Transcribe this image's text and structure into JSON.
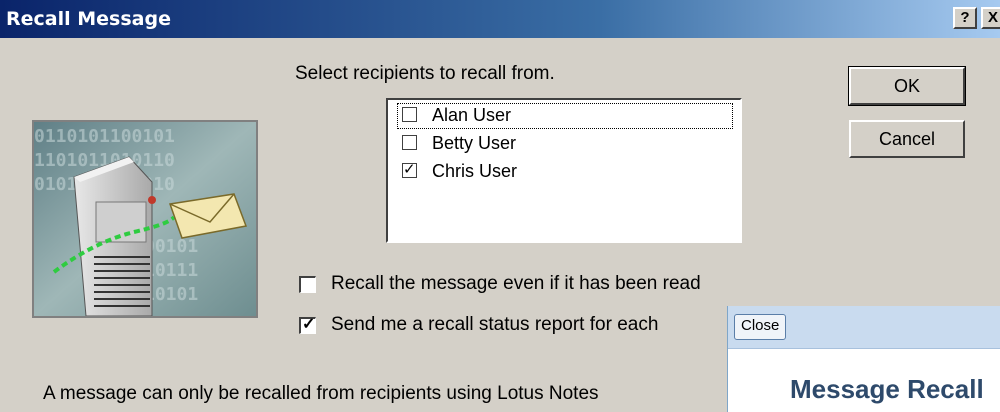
{
  "window": {
    "title": "Recall Message",
    "help_label": "?",
    "close_label": "X"
  },
  "instructions": "Select recipients to recall from.",
  "recipients": [
    {
      "name": "Alan User",
      "checked": false,
      "focused": true
    },
    {
      "name": "Betty User",
      "checked": false,
      "focused": false
    },
    {
      "name": "Chris User",
      "checked": true,
      "focused": false
    }
  ],
  "buttons": {
    "ok": "OK",
    "cancel": "Cancel"
  },
  "options": {
    "recall_if_read": {
      "label": "Recall the message even if it has been read",
      "checked": false
    },
    "status_report": {
      "label": "Send me a recall status report for each",
      "checked": true
    }
  },
  "footer_text": "A message can only be recalled from recipients using Lotus Notes",
  "overlay": {
    "close_label": "Close",
    "title": "Message Recall"
  },
  "colors": {
    "titlebar_start": "#0a246a",
    "dialog_bg": "#d4d0c8",
    "overlay_bar": "#c9dbef",
    "overlay_title": "#2e4a6b"
  },
  "icons": {
    "illustration": "mail-server-illustration",
    "check": "checkmark-icon"
  }
}
